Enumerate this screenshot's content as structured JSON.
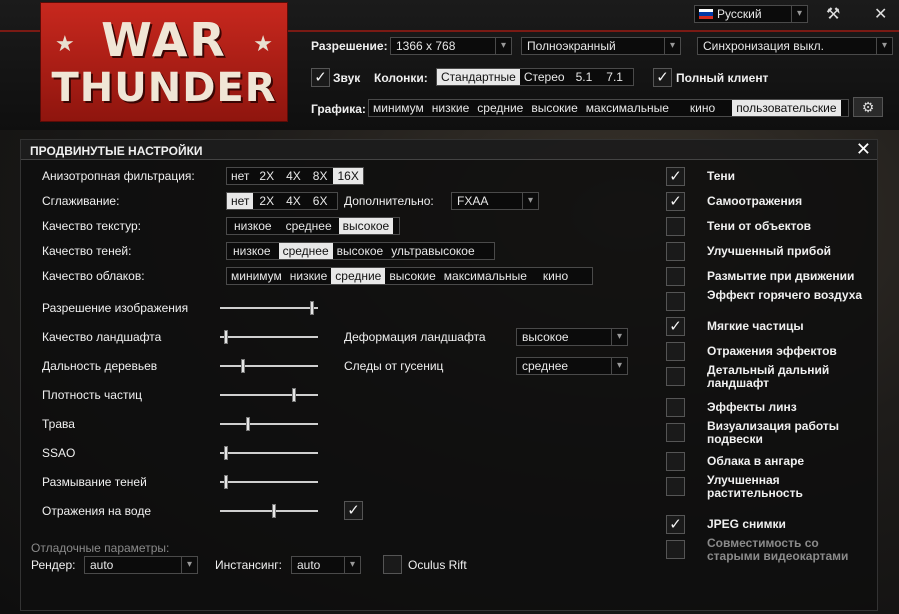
{
  "language": {
    "label": "Русский",
    "flag_colors": [
      "#ffffff",
      "#0039a6",
      "#d52b1e"
    ]
  },
  "logo": {
    "line1": "WAR",
    "line2": "THUNDER"
  },
  "top": {
    "resolution_label": "Разрешение:",
    "resolution_value": "1366 x 768",
    "screen_mode": "Полноэкранный",
    "vsync": "Синхронизация выкл.",
    "sound_label": "Звук",
    "speakers_label": "Колонки:",
    "speakers_options": [
      "Стандартные",
      "Стерео",
      "5.1",
      "7.1"
    ],
    "full_client_label": "Полный клиент",
    "graphics_label": "Графика:",
    "graphics_options": [
      "минимум",
      "низкие",
      "средние",
      "высокие",
      "максимальные",
      "кино",
      "пользовательские"
    ]
  },
  "panel": {
    "title": "ПРОДВИНУТЫЕ НАСТРОЙКИ",
    "aniso_label": "Анизотропная фильтрация:",
    "aniso_options": [
      "нет",
      "2X",
      "4X",
      "8X",
      "16X"
    ],
    "aa_label": "Сглаживание:",
    "aa_options": [
      "нет",
      "2X",
      "4X",
      "6X"
    ],
    "extra_label": "Дополнительно:",
    "extra_value": "FXAA",
    "texture_label": "Качество текстур:",
    "texture_options": [
      "низкое",
      "среднее",
      "высокое"
    ],
    "shadow_label": "Качество теней:",
    "shadow_options": [
      "низкое",
      "среднее",
      "высокое",
      "ультравысокое"
    ],
    "cloud_label": "Качество облаков:",
    "cloud_options": [
      "минимум",
      "низкие",
      "средние",
      "высокие",
      "максимальные",
      "кино"
    ],
    "sliders": [
      {
        "label": "Разрешение изображения",
        "value": 0.96
      },
      {
        "label": "Качество ландшафта",
        "value": 0.04
      },
      {
        "label": "Дальность деревьев",
        "value": 0.22
      },
      {
        "label": "Плотность частиц",
        "value": 0.77
      },
      {
        "label": "Трава",
        "value": 0.28
      },
      {
        "label": "SSAO",
        "value": 0.04
      },
      {
        "label": "Размывание теней",
        "value": 0.04
      },
      {
        "label": "Отражения на воде",
        "value": 0.55
      }
    ],
    "terrain_deform_label": "Деформация ландшафта",
    "terrain_deform_value": "высокое",
    "tracks_label": "Следы от гусениц",
    "tracks_value": "среднее",
    "debug_label": "Отладочные параметры:",
    "render_label": "Рендер:",
    "render_value": "auto",
    "instancing_label": "Инстансинг:",
    "instancing_value": "auto",
    "oculus_label": "Oculus Rift",
    "checks": [
      {
        "label": "Тени",
        "checked": true
      },
      {
        "label": "Самоотражения",
        "checked": true
      },
      {
        "label": "Тени от объектов",
        "checked": false
      },
      {
        "label": "Улучшенный прибой",
        "checked": false
      },
      {
        "label": "Размытие при движении",
        "checked": false
      },
      {
        "label": "Эффект горячего воздуха",
        "checked": false
      },
      {
        "label": "Мягкие частицы",
        "checked": true
      },
      {
        "label": "Отражения эффектов",
        "checked": false
      },
      {
        "label": "Детальный дальний ландшафт",
        "checked": false
      },
      {
        "label": "Эффекты линз",
        "checked": false
      },
      {
        "label": "Визуализация работы подвески",
        "checked": false
      },
      {
        "label": "Облака в ангаре",
        "checked": false
      },
      {
        "label": "Улучшенная растительность",
        "checked": false
      },
      {
        "label": "JPEG снимки",
        "checked": true
      },
      {
        "label": "Совместимость со старыми видеокартами",
        "checked": false
      }
    ]
  },
  "glyphs": {
    "check": "✓",
    "arrow": "▾",
    "close": "✕",
    "gear": "⚙",
    "star": "★"
  }
}
